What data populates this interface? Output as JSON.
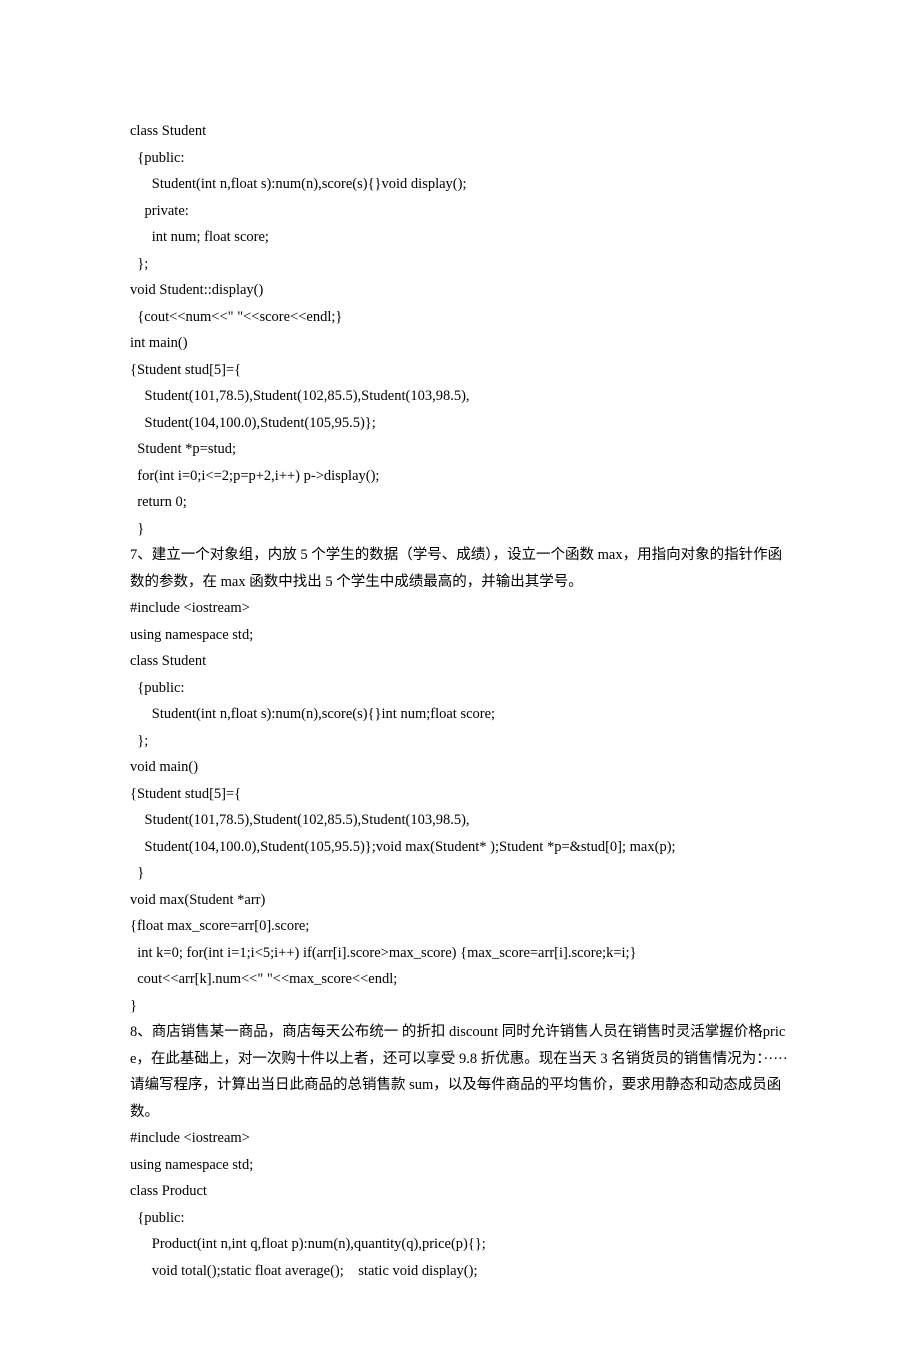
{
  "lines": [
    "class Student",
    "  {public:",
    "      Student(int n,float s):num(n),score(s){}void display();",
    "    private:",
    "      int num; float score;",
    "  };",
    "void Student::display()",
    "  {cout<<num<<\" \"<<score<<endl;}",
    "int main()",
    "{Student stud[5]={",
    "    Student(101,78.5),Student(102,85.5),Student(103,98.5),",
    "    Student(104,100.0),Student(105,95.5)};",
    "  Student *p=stud;",
    "  for(int i=0;i<=2;p=p+2,i++) p->display();",
    "  return 0;",
    "  }",
    "7、建立一个对象组，内放 5 个学生的数据（学号、成绩），设立一个函数 max，用指向对象的指针作函数的参数，在 max 函数中找出 5 个学生中成绩最高的，并输出其学号。",
    "#include <iostream>",
    "using namespace std;",
    "class Student",
    "  {public:",
    "      Student(int n,float s):num(n),score(s){}int num;float score;",
    "  };",
    "void main()",
    "{Student stud[5]={",
    "    Student(101,78.5),Student(102,85.5),Student(103,98.5),",
    "    Student(104,100.0),Student(105,95.5)};void max(Student* );Student *p=&stud[0]; max(p);",
    "  }",
    "void max(Student *arr)",
    "{float max_score=arr[0].score;",
    "  int k=0; for(int i=1;i<5;i++) if(arr[i].score>max_score) {max_score=arr[i].score;k=i;}",
    "  cout<<arr[k].num<<\" \"<<max_score<<endl;",
    "}",
    "8、商店销售某一商品，商店每天公布统一 的折扣 discount 同时允许销售人员在销售时灵活掌握价格price，在此基础上，对一次购十件以上者，还可以享受 9.8 折优惠。现在当天 3 名销货员的销售情况为：····· 请编写程序，计算出当日此商品的总销售款 sum，以及每件商品的平均售价，要求用静态和动态成员函数。",
    "#include <iostream>",
    "using namespace std;",
    "class Product",
    "  {public:",
    "      Product(int n,int q,float p):num(n),quantity(q),price(p){};",
    "      void total();static float average();    static void display();"
  ],
  "cnLines": [
    16,
    33
  ]
}
